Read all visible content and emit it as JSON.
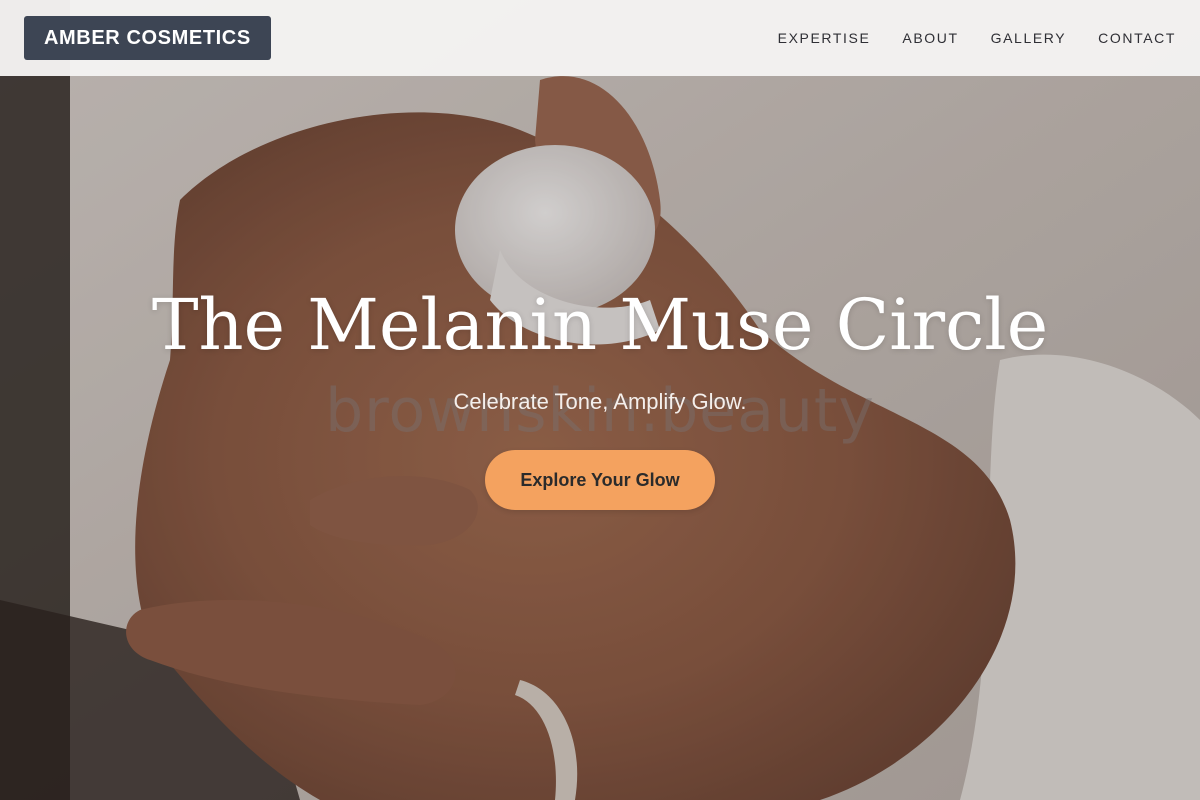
{
  "header": {
    "logo_text": "AMBER COSMETICS",
    "nav": [
      {
        "label": "EXPERTISE"
      },
      {
        "label": "ABOUT"
      },
      {
        "label": "GALLERY"
      },
      {
        "label": "CONTACT"
      }
    ]
  },
  "hero": {
    "title": "The Melanin Muse Circle",
    "subtitle": "Celebrate Tone, Amplify Glow.",
    "watermark": "brownskin.beauty",
    "cta_label": "Explore Your Glow",
    "background_image": "hands-applying-cream-photo"
  },
  "colors": {
    "header_bg": "#f4f3f2",
    "logo_bg": "#3d4554",
    "cta_bg": "#f4a25f",
    "nav_text": "#2f2f35",
    "title_text": "#ffffff"
  }
}
